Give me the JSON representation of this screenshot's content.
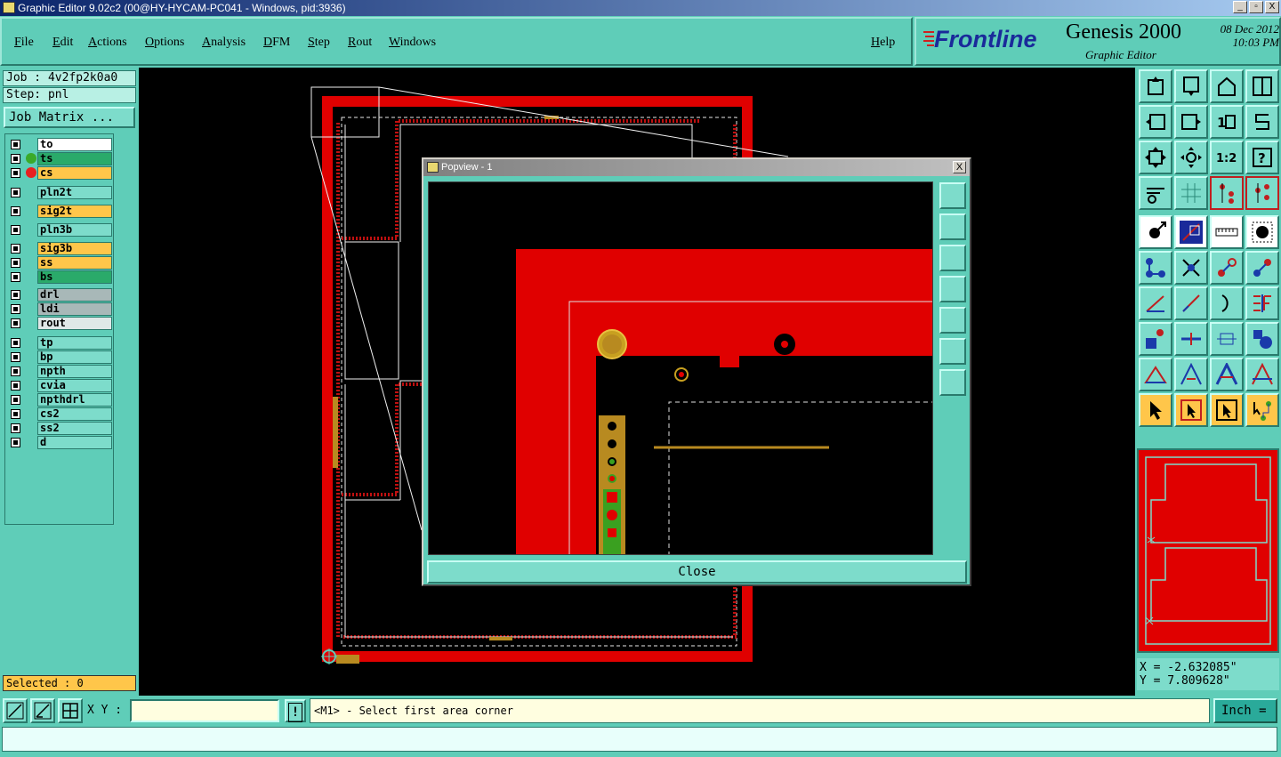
{
  "window": {
    "title": "Graphic Editor 9.02c2 (00@HY-HYCAM-PC041 - Windows, pid:3936)",
    "buttons": [
      "_",
      "▫",
      "X"
    ]
  },
  "menu": {
    "file": "File",
    "edit": "Edit",
    "actions": "Actions",
    "options": "Options",
    "analysis": "Analysis",
    "dfm": "DFM",
    "step": "Step",
    "rout": "Rout",
    "windows": "Windows",
    "help": "Help"
  },
  "brand": {
    "logo": "Frontline",
    "product": "Genesis 2000",
    "subtitle": "Graphic Editor",
    "date": "08 Dec 2012",
    "time": "10:03 PM"
  },
  "job": {
    "job_line": "Job : 4v2fp2k0a0",
    "step_line": "Step: pnl",
    "matrix_button": "Job Matrix ..."
  },
  "layers": [
    {
      "name": "to",
      "color": "#ffffff",
      "dot": ""
    },
    {
      "name": "ts",
      "color": "#2aaa6a",
      "dot": "#3aaa2a"
    },
    {
      "name": "cs",
      "color": "#ffc64a",
      "dot": "#e82020"
    },
    {
      "name": "pln2t",
      "color": "#7ddccb",
      "dot": ""
    },
    {
      "name": "sig2t",
      "color": "#ffc64a",
      "dot": ""
    },
    {
      "name": "pln3b",
      "color": "#7ddccb",
      "dot": ""
    },
    {
      "name": "sig3b",
      "color": "#ffc64a",
      "dot": ""
    },
    {
      "name": "ss",
      "color": "#ffc64a",
      "dot": ""
    },
    {
      "name": "bs",
      "color": "#2aaa6a",
      "dot": ""
    },
    {
      "name": "drl",
      "color": "#a8b8b8",
      "dot": ""
    },
    {
      "name": "ldi",
      "color": "#a8b8b8",
      "dot": ""
    },
    {
      "name": "rout",
      "color": "#e0e8e8",
      "dot": ""
    },
    {
      "name": "tp",
      "color": "#7ddccb",
      "dot": ""
    },
    {
      "name": "bp",
      "color": "#7ddccb",
      "dot": ""
    },
    {
      "name": "npth",
      "color": "#7ddccb",
      "dot": ""
    },
    {
      "name": "cvia",
      "color": "#7ddccb",
      "dot": ""
    },
    {
      "name": "npthdrl",
      "color": "#7ddccb",
      "dot": ""
    },
    {
      "name": "cs2",
      "color": "#7ddccb",
      "dot": ""
    },
    {
      "name": "ss2",
      "color": "#7ddccb",
      "dot": ""
    },
    {
      "name": "d",
      "color": "#7ddccb",
      "dot": ""
    }
  ],
  "selected": "Selected : 0",
  "popview": {
    "title": "Popview - 1",
    "close_x": "X",
    "close_button": "Close"
  },
  "coords": {
    "x": "X = -2.632085\"",
    "y": "Y = 7.809628\""
  },
  "status": {
    "xy_label": "X Y :",
    "xy_value": "",
    "excl": "!",
    "prompt": "<M1> - Select first area corner",
    "unit": "Inch ="
  }
}
